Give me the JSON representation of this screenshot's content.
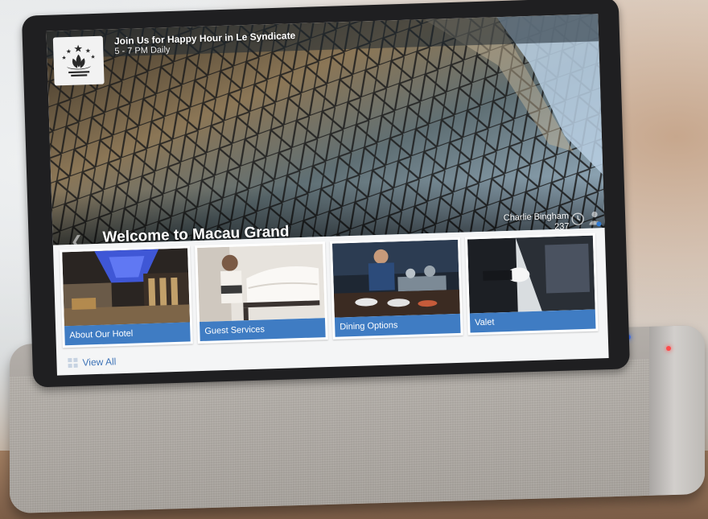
{
  "promo": {
    "title": "Join Us for Happy Hour in Le Syndicate",
    "subtitle": "5 - 7 PM Daily"
  },
  "hero": {
    "welcome": "Welcome to Macau Grand",
    "guest_name": "Charlie Bingham",
    "room_number": "237"
  },
  "tiles": [
    {
      "label": "About Our Hotel",
      "image": "hotel-lobby"
    },
    {
      "label": "Guest Services",
      "image": "housekeeping-cart"
    },
    {
      "label": "Dining Options",
      "image": "chef-kitchen"
    },
    {
      "label": "Valet",
      "image": "car-door-valet"
    }
  ],
  "footer": {
    "view_all": "View All"
  },
  "icons": {
    "logo": "lotus-emblem-icon",
    "back": "back-arrow-icon",
    "clock": "clock-icon",
    "person": "person-icon",
    "grid": "grid-icon"
  },
  "colors": {
    "tile_label": "#3f7cc3",
    "link": "#3f74b7",
    "dock": "#a8a39d",
    "bezel": "#1f1f21"
  }
}
